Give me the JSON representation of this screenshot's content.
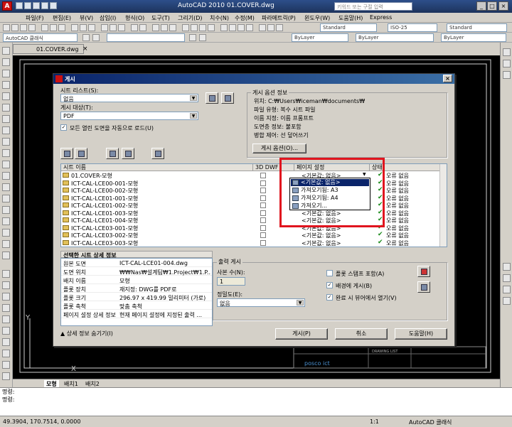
{
  "app": {
    "title": "AutoCAD 2010    01.COVER.dwg",
    "search_placeholder": "키워드 또는 구절 입력"
  },
  "menu": [
    "파일(F)",
    "편집(E)",
    "뷰(V)",
    "삽입(I)",
    "형식(O)",
    "도구(T)",
    "그리기(D)",
    "치수(N)",
    "수정(M)",
    "파라메트릭(P)",
    "윈도우(W)",
    "도움말(H)",
    "Express"
  ],
  "toolbar": {
    "workspace": "AutoCAD 클래식",
    "text_style": "Standard",
    "dim_style": "ISO-25",
    "table_style": "Standard",
    "layer_color": "ByLayer",
    "linetype": "ByLayer",
    "lineweight": "ByLayer"
  },
  "doc_tab": "01.COVER.dwg",
  "layout_tabs": [
    "모형",
    "배치1",
    "배치2"
  ],
  "command_lines": [
    "명령:",
    "명령:"
  ],
  "status": {
    "coords": "49.3904,  170.7514,  0.0000",
    "scale": "1:1",
    "workspace": "AutoCAD 클래식"
  },
  "dialog": {
    "title": "게시",
    "sheet_list_label": "시트 리스트(S):",
    "sheet_list_value": "없음",
    "publish_to_label": "게시 대상(T):",
    "publish_to_value": "PDF",
    "auto_load_label": "모든 열린 도면을 자동으로 로드(U)",
    "options_group": "게시 옵션 정보",
    "options_info": [
      "위치: C:₩Users₩iceman₩documents₩",
      "파일 유형: 복수 시트 파일",
      "이름 지정: 이름 프롬프트",
      "도면층 정보: 불포함",
      "병합 제어: 선 덮어쓰기"
    ],
    "options_button": "게시 옵션(O)...",
    "columns": [
      "시트 이름",
      "3D DWF",
      "페이지 설정",
      "상태"
    ],
    "sheets": [
      {
        "name": "01.COVER-모형",
        "setup": "<기본값: 없음>",
        "status": "오류 없음"
      },
      {
        "name": "ICT-CAL-LCE00-001-모형",
        "setup": "",
        "status": "오류 없음"
      },
      {
        "name": "ICT-CAL-LCE00-002-모형",
        "setup": "",
        "status": "오류 없음"
      },
      {
        "name": "ICT-CAL-LCE01-001-모형",
        "setup": "",
        "status": "오류 없음"
      },
      {
        "name": "ICT-CAL-LCE01-002-모형",
        "setup": "",
        "status": "오류 없음"
      },
      {
        "name": "ICT-CAL-LCE01-003-모형",
        "setup": "<기본값: 없음>",
        "status": "오류 없음"
      },
      {
        "name": "ICT-CAL-LCE01-004-모형",
        "setup": "<기본값: 없음>",
        "status": "오류 없음"
      },
      {
        "name": "ICT-CAL-LCE03-001-모형",
        "setup": "<기본값: 없음>",
        "status": "오류 없음"
      },
      {
        "name": "ICT-CAL-LCE03-002-모형",
        "setup": "<기본값: 없음>",
        "status": "오류 없음"
      },
      {
        "name": "ICT-CAL-LCE03-003-모형",
        "setup": "<기본값: 없음>",
        "status": "오류 없음"
      }
    ],
    "dropdown": [
      "<기본값: 없음>",
      "가져오기됨: A3",
      "가져오기됨: A4",
      "가져오기..."
    ],
    "details_title": "선택한 시트 상세 정보",
    "details": [
      {
        "k": "원본 도면",
        "v": "ICT-CAL-LCE01-004.dwg"
      },
      {
        "k": "도면 위치",
        "v": "₩₩Nas₩설계팀₩1.Project₩1.P..."
      },
      {
        "k": "배치 이름",
        "v": "모형"
      },
      {
        "k": "플롯 장치",
        "v": "재지정: DWG를 PDF로"
      },
      {
        "k": "플롯 크기",
        "v": "296.97 x 419.99 밀리미터 (가로)"
      },
      {
        "k": "플롯 축척",
        "v": "맞춤 축척"
      },
      {
        "k": "페이지 설정 상세 정보",
        "v": "현재 페이지 설정에 지정된 출력 ..."
      }
    ],
    "output_group": "출력 게시",
    "copies_label": "사본 수(N):",
    "copies_value": "1",
    "precision_label": "정밀도(E):",
    "precision_value": "없음",
    "include_stamp": "플롯 스탬프 포함(A)",
    "bg_publish": "배경에 게시(B)",
    "open_viewer": "완료 시 뷰어에서 열기(V)",
    "hide_details": "상세 정보 숨기기(I)",
    "publish_button": "게시(P)",
    "cancel_button": "취소",
    "help_button": "도움말(H)"
  },
  "titleblock": {
    "label": "DRAWING LIST",
    "brand": "posco ict"
  },
  "colors": {
    "highlight": "#e0141e",
    "dialog_title": "#0a246a",
    "check_green": "#1a8a1a"
  }
}
